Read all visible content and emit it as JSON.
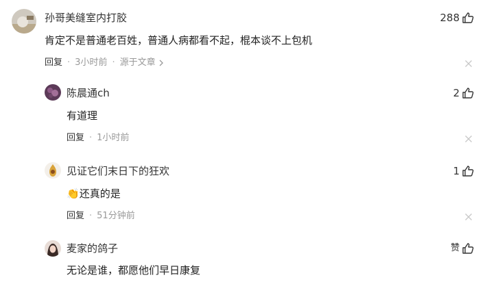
{
  "comments": [
    {
      "name": "孙哥美缝室内打胶",
      "text": "肯定不是普通老百姓，普通人病都看不起，棍本谈不上包机",
      "reply": "回复",
      "time": "3小时前",
      "source": "源于文章",
      "likes": "288"
    }
  ],
  "replies": [
    {
      "name": "陈晨通ch",
      "text": "有道理",
      "reply": "回复",
      "time": "1小时前",
      "likes": "2"
    },
    {
      "name": "见证它们末日下的狂欢",
      "emoji": "👏",
      "text": "还真的是",
      "reply": "回复",
      "time": "51分钟前",
      "likes": "1"
    },
    {
      "name": "麦家的鸽子",
      "text": "无论是谁，都愿他们早日康复",
      "likes": "赞"
    }
  ],
  "meta_separator": "·",
  "colors": {
    "name": "#333333",
    "meta": "#999999",
    "text": "#222222"
  }
}
